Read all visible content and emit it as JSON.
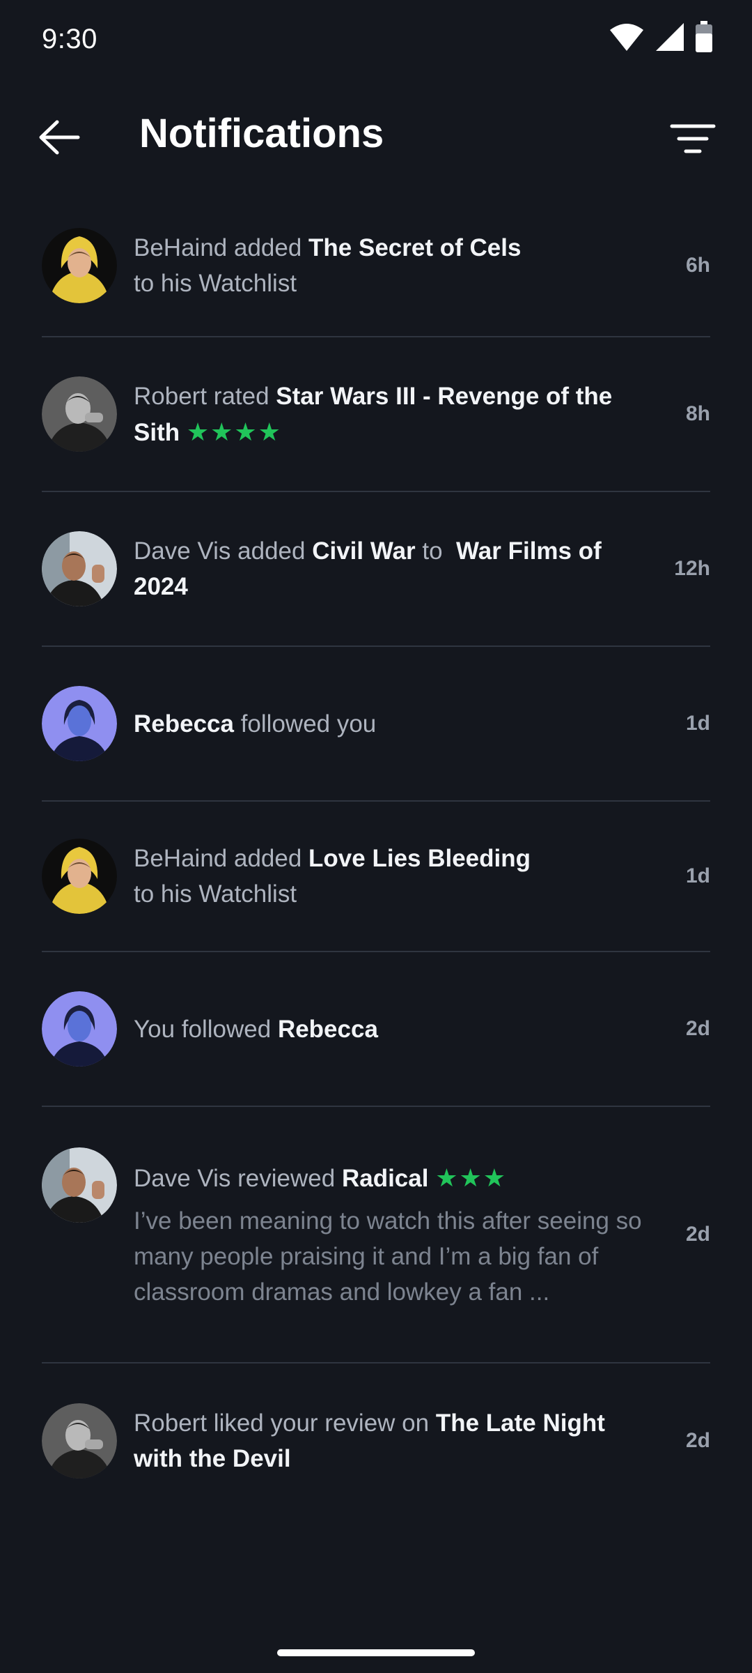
{
  "status_bar": {
    "time": "9:30"
  },
  "header": {
    "title": "Notifications"
  },
  "notifications": [
    {
      "avatar": "avatar-behaind",
      "actor": "BeHaind",
      "action": " added ",
      "object": "The Secret of Cels",
      "suffix": " to his Watchlist",
      "time": "6h"
    },
    {
      "avatar": "avatar-robert",
      "actor": "Robert",
      "action": " rated ",
      "object": "Star Wars III - Revenge of the Sith",
      "stars": "★★★★",
      "rating": 4,
      "time": "8h"
    },
    {
      "avatar": "avatar-dave",
      "actor": "Dave Vis",
      "action": " added ",
      "object": "Civil War",
      "mid": " to ",
      "object2": "War Films of 2024",
      "time": "12h"
    },
    {
      "avatar": "avatar-rebecca",
      "actor": "Rebecca",
      "action": " followed you",
      "time": "1d"
    },
    {
      "avatar": "avatar-behaind",
      "actor": "BeHaind",
      "action": " added ",
      "object": "Love Lies Bleeding",
      "suffix": " to his Watchlist",
      "time": "1d"
    },
    {
      "avatar": "avatar-rebecca",
      "prefix": "You followed ",
      "object": "Rebecca",
      "time": "2d"
    },
    {
      "avatar": "avatar-dave",
      "actor": "Dave Vis",
      "action": " reviewed ",
      "object": "Radical",
      "stars": "★★★",
      "rating": 3,
      "excerpt": "I’ve been meaning to watch this after seeing so many people praising it and I’m a big fan of classroom dramas and lowkey a fan ...",
      "time": "2d"
    },
    {
      "avatar": "avatar-robert",
      "actor": "Robert",
      "action": " liked your review on ",
      "object": "The Late Night with the Devil",
      "time": "2d"
    }
  ],
  "colors": {
    "background": "#14171e",
    "star": "#21c45a",
    "divider": "#2f3540"
  }
}
